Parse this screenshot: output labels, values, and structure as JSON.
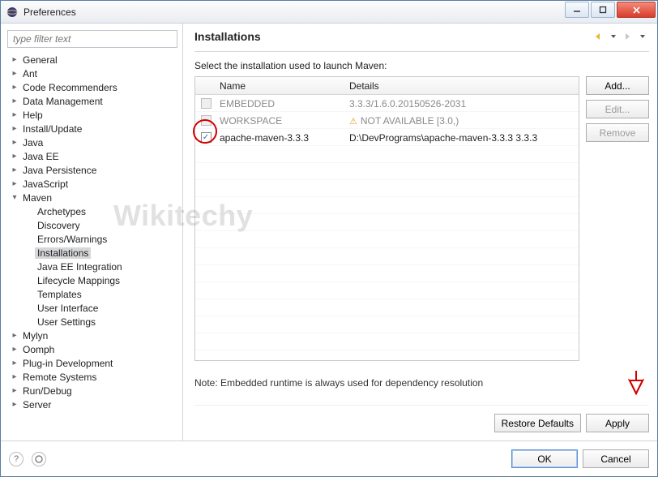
{
  "window": {
    "title": "Preferences"
  },
  "sidebar": {
    "filter_placeholder": "type filter text",
    "items": [
      {
        "label": "General",
        "exp": "collapsed"
      },
      {
        "label": "Ant",
        "exp": "collapsed"
      },
      {
        "label": "Code Recommenders",
        "exp": "collapsed"
      },
      {
        "label": "Data Management",
        "exp": "collapsed"
      },
      {
        "label": "Help",
        "exp": "collapsed"
      },
      {
        "label": "Install/Update",
        "exp": "collapsed"
      },
      {
        "label": "Java",
        "exp": "collapsed"
      },
      {
        "label": "Java EE",
        "exp": "collapsed"
      },
      {
        "label": "Java Persistence",
        "exp": "collapsed"
      },
      {
        "label": "JavaScript",
        "exp": "collapsed"
      },
      {
        "label": "Maven",
        "exp": "expanded",
        "children": [
          {
            "label": "Archetypes"
          },
          {
            "label": "Discovery"
          },
          {
            "label": "Errors/Warnings"
          },
          {
            "label": "Installations",
            "selected": true
          },
          {
            "label": "Java EE Integration"
          },
          {
            "label": "Lifecycle Mappings"
          },
          {
            "label": "Templates"
          },
          {
            "label": "User Interface"
          },
          {
            "label": "User Settings"
          }
        ]
      },
      {
        "label": "Mylyn",
        "exp": "collapsed"
      },
      {
        "label": "Oomph",
        "exp": "collapsed"
      },
      {
        "label": "Plug-in Development",
        "exp": "collapsed"
      },
      {
        "label": "Remote Systems",
        "exp": "collapsed"
      },
      {
        "label": "Run/Debug",
        "exp": "collapsed"
      },
      {
        "label": "Server",
        "exp": "collapsed"
      }
    ]
  },
  "main": {
    "title": "Installations",
    "instruction": "Select the installation used to launch Maven:",
    "columns": {
      "name": "Name",
      "details": "Details"
    },
    "rows": [
      {
        "checked": false,
        "disabled": true,
        "name": "EMBEDDED",
        "details": "3.3.3/1.6.0.20150526-2031"
      },
      {
        "checked": false,
        "disabled": true,
        "name": "WORKSPACE",
        "details": "NOT AVAILABLE [3.0,)",
        "warn": true
      },
      {
        "checked": true,
        "disabled": false,
        "name": "apache-maven-3.3.3",
        "details": "D:\\DevPrograms\\apache-maven-3.3.3 3.3.3"
      }
    ],
    "buttons": {
      "add": "Add...",
      "edit": "Edit...",
      "remove": "Remove"
    },
    "note": "Note: Embedded runtime is always used for dependency resolution",
    "restore": "Restore Defaults",
    "apply": "Apply"
  },
  "dialog": {
    "ok": "OK",
    "cancel": "Cancel"
  },
  "watermark": "Wikitechy"
}
